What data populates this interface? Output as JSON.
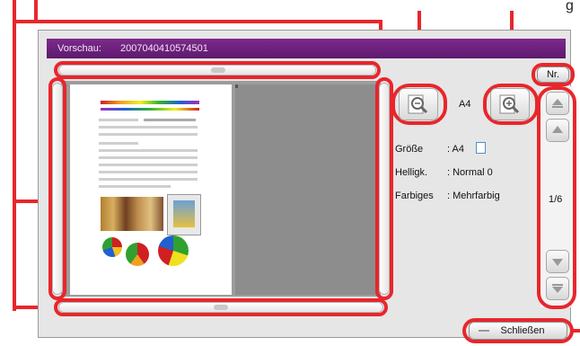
{
  "window": {
    "title_label": "Vorschau:",
    "document_id": "2007040410574501"
  },
  "paper_size_label": "A4",
  "info": {
    "size_label": "Größe",
    "size_value": ": A4",
    "brightness_label": "Helligk.",
    "brightness_value": ": Normal 0",
    "color_label": "Farbiges",
    "color_value": ": Mehrfarbig"
  },
  "page_indicator": "1/6",
  "number_button": "Nr.",
  "close_button": "Schließen",
  "top_callout_text": "g",
  "icons": [
    "zoom-out-icon",
    "zoom-in-icon",
    "page-up-icon",
    "page-down-icon",
    "first-page-icon",
    "last-page-icon",
    "paper-orientation-icon"
  ],
  "colors": {
    "title_bar": "#6e2380",
    "callout": "#e8262c"
  }
}
